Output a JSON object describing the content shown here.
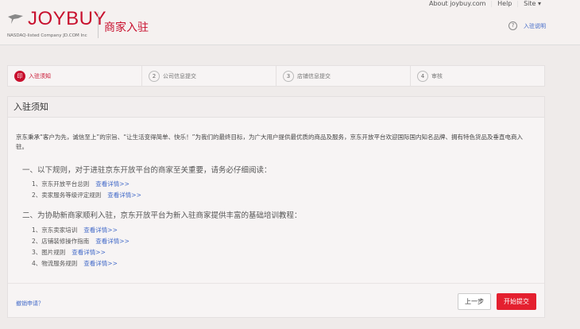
{
  "header": {
    "logo": "JOYBUY",
    "tagline": "NASDAQ-listed Company JD.COM Inc",
    "section": "商家入驻",
    "top_links": [
      "About joybuy.com",
      "Help",
      "Site"
    ],
    "help_link": "入驻说明",
    "help_icon": "?"
  },
  "steps": [
    {
      "num": "",
      "label": "入驻须知"
    },
    {
      "num": "2",
      "label": "公司信息提交"
    },
    {
      "num": "3",
      "label": "店铺信息提交"
    },
    {
      "num": "4",
      "label": "审核"
    }
  ],
  "card": {
    "title": "入驻须知",
    "intro": "京东秉承“客户为先，诚信至上”的宗旨、“让生活变得简单、快乐！”为我们的最终目标，为广大用户提供最优质的商品及服务，京东开放平台欢迎国际国内知名品牌、拥有特色货品及垂直电商入驻。",
    "section1": "一、以下规则，对于进驻京东开放平台的商家至关重要，请务必仔细阅读：",
    "list1": [
      {
        "label": "1、京东开放平台总则",
        "link": "查看详情>>"
      },
      {
        "label": "2、卖家服务等级评定规则",
        "link": "查看详情>>"
      }
    ],
    "section2": "二、为协助新商家顺利入驻，京东开放平台为新入驻商家提供丰富的基础培训教程：",
    "list2": [
      {
        "label": "1、京东卖家培训",
        "link": "查看详情>>"
      },
      {
        "label": "2、店铺装修操作指南",
        "link": "查看详情>>"
      },
      {
        "label": "3、图片规则",
        "link": "查看详情>>"
      },
      {
        "label": "4、物流服务规则",
        "link": "查看详情>>"
      }
    ]
  },
  "footer": {
    "cancel": "撤销申请？",
    "prev": "上一步",
    "submit": "开始提交"
  }
}
